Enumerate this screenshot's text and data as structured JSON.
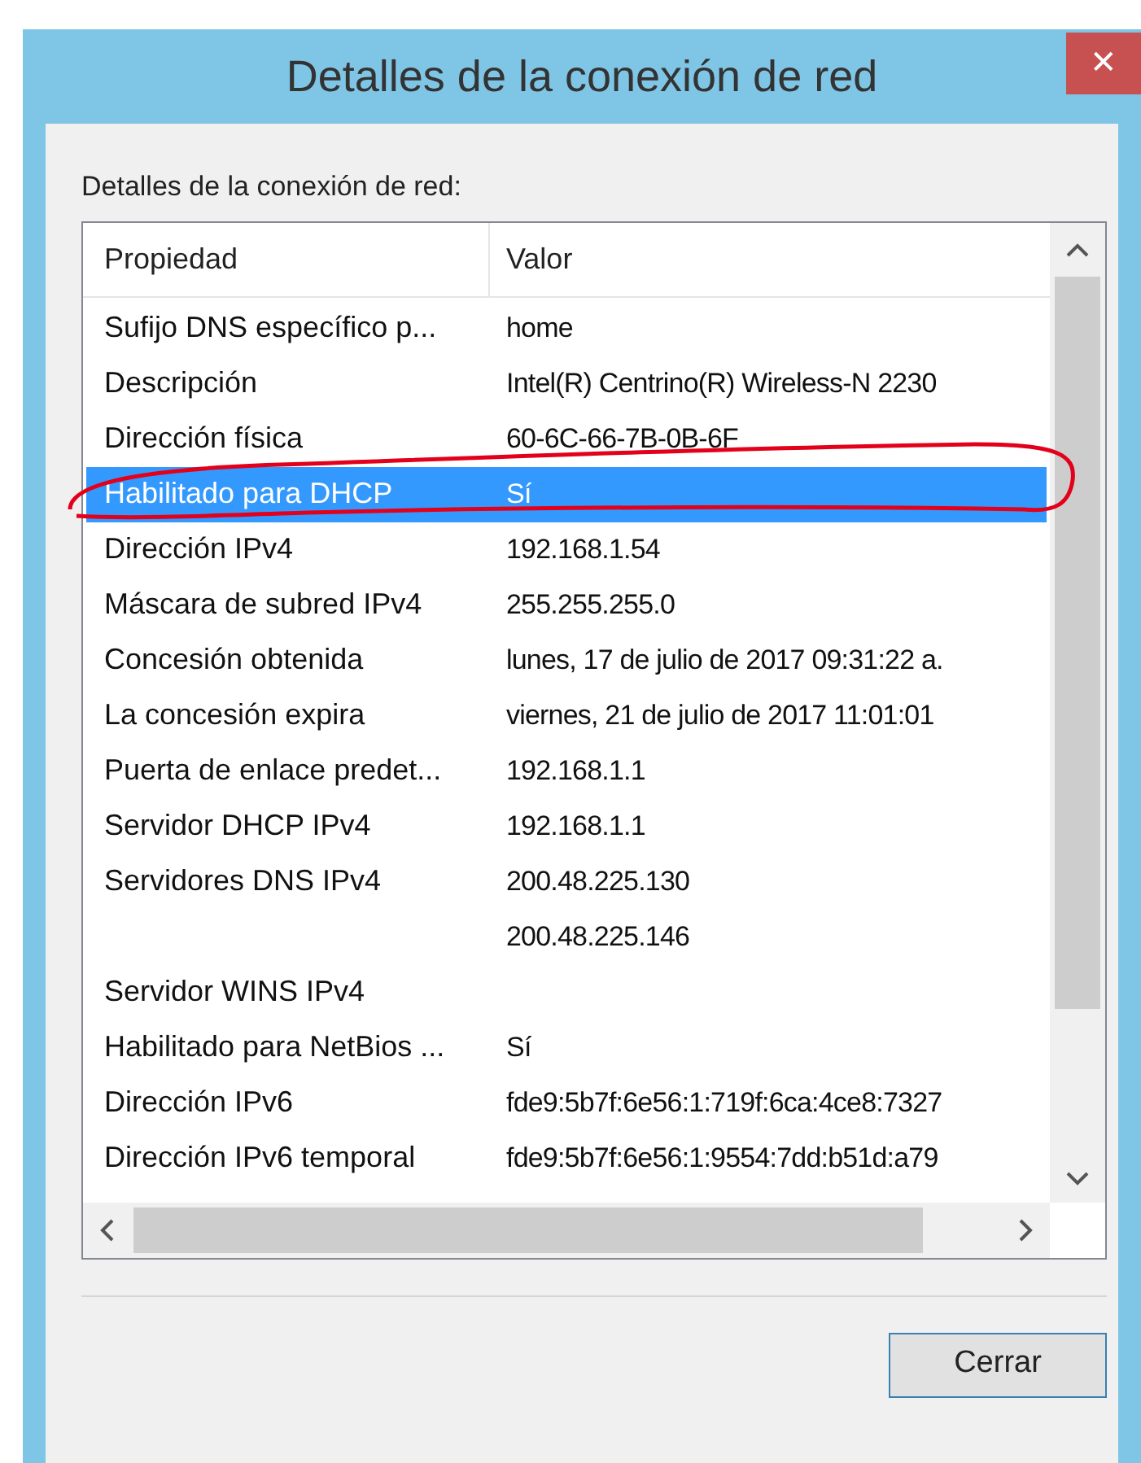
{
  "window": {
    "title": "Detalles de la conexión de red",
    "close": "✕"
  },
  "group_label": "Detalles de la conexión de red:",
  "table": {
    "columns": [
      "Propiedad",
      "Valor"
    ],
    "rows": [
      {
        "property": "Sufijo DNS específico p...",
        "value": "home",
        "selected": false
      },
      {
        "property": "Descripción",
        "value": "Intel(R) Centrino(R) Wireless-N 2230",
        "selected": false
      },
      {
        "property": "Dirección física",
        "value": "60-6C-66-7B-0B-6F",
        "selected": false
      },
      {
        "property": "Habilitado para DHCP",
        "value": "Sí",
        "selected": true
      },
      {
        "property": "Dirección IPv4",
        "value": "192.168.1.54",
        "selected": false
      },
      {
        "property": "Máscara de subred IPv4",
        "value": "255.255.255.0",
        "selected": false
      },
      {
        "property": "Concesión obtenida",
        "value": "lunes, 17 de julio de 2017 09:31:22 a.",
        "selected": false
      },
      {
        "property": "La concesión expira",
        "value": "viernes, 21 de julio de 2017 11:01:01",
        "selected": false
      },
      {
        "property": "Puerta de enlace predet...",
        "value": "192.168.1.1",
        "selected": false
      },
      {
        "property": "Servidor DHCP IPv4",
        "value": "192.168.1.1",
        "selected": false
      },
      {
        "property": "Servidores DNS IPv4",
        "value": "200.48.225.130",
        "selected": false
      },
      {
        "value": "200.48.225.146",
        "selected": false
      },
      {
        "property": "Servidor WINS IPv4",
        "selected": false
      },
      {
        "property": "Habilitado para NetBios ...",
        "value": "Sí",
        "selected": false
      },
      {
        "property": "Dirección IPv6",
        "value": "fde9:5b7f:6e56:1:719f:6ca:4ce8:7327",
        "selected": false
      },
      {
        "property": "Dirección IPv6 temporal",
        "value": "fde9:5b7f:6e56:1:9554:7dd:b51d:a79",
        "selected": false
      }
    ]
  },
  "buttons": [
    "Cerrar"
  ]
}
